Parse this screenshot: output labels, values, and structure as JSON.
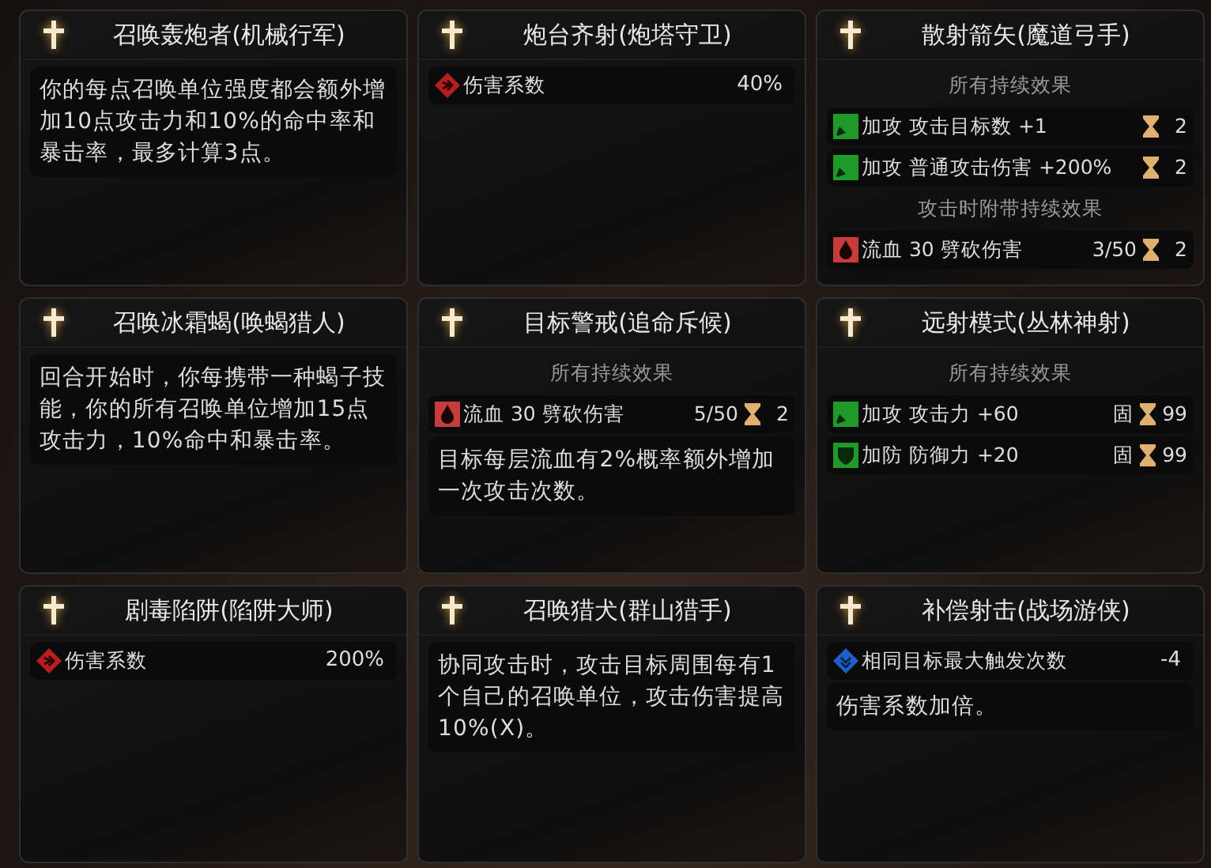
{
  "cards": [
    {
      "title": "召唤轰炮者(机械行军)",
      "blocks": [
        {
          "kind": "text",
          "text": "你的每点召唤单位强度都会额外增加10点攻击力和10%的命中率和暴击率，最多计算3点。"
        }
      ]
    },
    {
      "title": "炮台齐射(炮塔守卫)",
      "blocks": [
        {
          "kind": "damage",
          "label": "伤害系数",
          "value": "40%"
        }
      ]
    },
    {
      "title": "散射箭矢(魔道弓手)",
      "blocks": [
        {
          "kind": "heading",
          "text": "所有持续效果"
        },
        {
          "kind": "attack",
          "label": "加攻 攻击目标数 +1",
          "duration": "2"
        },
        {
          "kind": "attack",
          "label": "加攻 普通攻击伤害 +200%",
          "duration": "2"
        },
        {
          "kind": "heading",
          "text": "攻击时附带持续效果"
        },
        {
          "kind": "bleed",
          "label": "流血 30 劈砍伤害",
          "stacks": "3/50",
          "duration": "2"
        }
      ]
    },
    {
      "title": "召唤冰霜蝎(唤蝎猎人)",
      "blocks": [
        {
          "kind": "text",
          "text": "回合开始时，你每携带一种蝎子技能，你的所有召唤单位增加15点攻击力，10%命中和暴击率。"
        }
      ]
    },
    {
      "title": "目标警戒(追命斥候)",
      "blocks": [
        {
          "kind": "heading",
          "text": "所有持续效果"
        },
        {
          "kind": "bleed",
          "label": "流血 30 劈砍伤害",
          "stacks": "5/50",
          "duration": "2"
        },
        {
          "kind": "text",
          "text": "目标每层流血有2%概率额外增加一次攻击次数。"
        }
      ]
    },
    {
      "title": "远射模式(丛林神射)",
      "blocks": [
        {
          "kind": "heading",
          "text": "所有持续效果"
        },
        {
          "kind": "attack",
          "label": "加攻 攻击力 +60",
          "fixed": "固",
          "duration": "99"
        },
        {
          "kind": "defense",
          "label": "加防 防御力 +20",
          "fixed": "固",
          "duration": "99"
        }
      ]
    },
    {
      "title": "剧毒陷阱(陷阱大师)",
      "blocks": [
        {
          "kind": "damage",
          "label": "伤害系数",
          "value": "200%"
        }
      ]
    },
    {
      "title": "召唤猎犬(群山猎手)",
      "blocks": [
        {
          "kind": "text",
          "text": "协同攻击时，攻击目标周围每有1个自己的召唤单位，攻击伤害提高10%(X)。"
        }
      ]
    },
    {
      "title": "补偿射击(战场游侠)",
      "blocks": [
        {
          "kind": "trigger",
          "label": "相同目标最大触发次数",
          "value": "-4"
        },
        {
          "kind": "text",
          "text": "伤害系数加倍。"
        }
      ]
    }
  ]
}
